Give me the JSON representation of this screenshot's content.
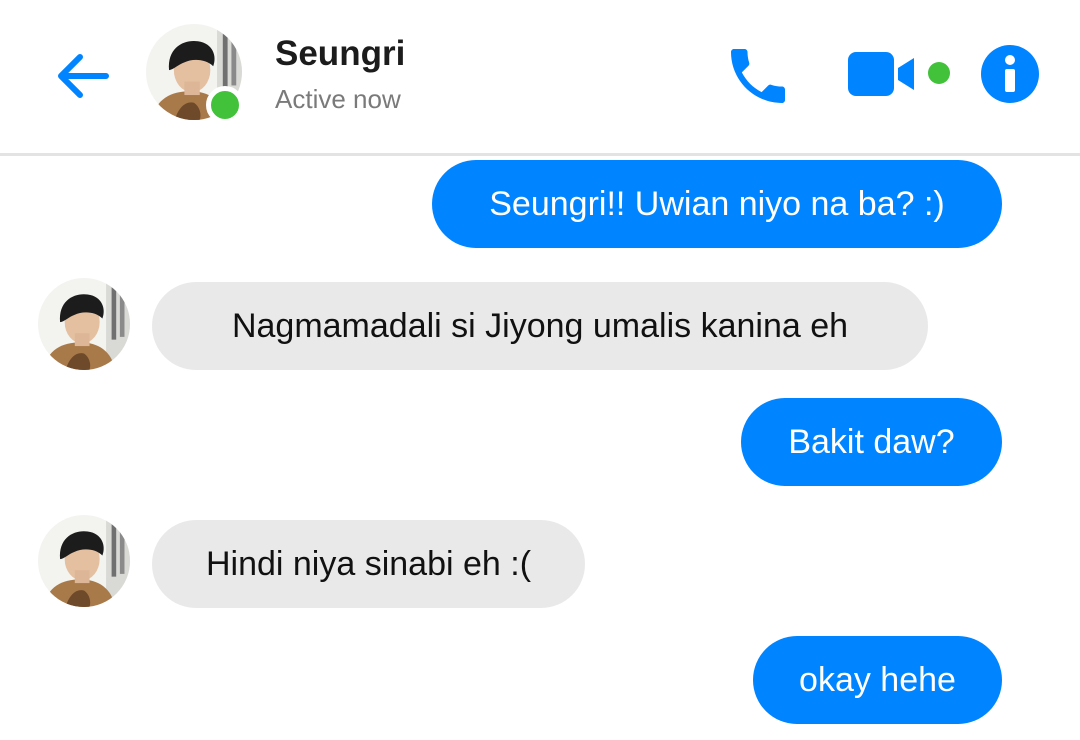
{
  "header": {
    "contact_name": "Seungri",
    "status": "Active now",
    "icons": {
      "back": "back-arrow-icon",
      "call": "phone-icon",
      "video": "video-camera-icon",
      "info": "info-icon"
    }
  },
  "colors": {
    "accent": "#0084ff",
    "online": "#42c23a",
    "incoming_bubble": "#e9e9e9",
    "divider": "#e3e3e3"
  },
  "messages": [
    {
      "direction": "outgoing",
      "text": "Seungri!! Uwian niyo na ba? :)"
    },
    {
      "direction": "incoming",
      "text": "Nagmamadali si Jiyong umalis kanina eh"
    },
    {
      "direction": "outgoing",
      "text": "Bakit daw?"
    },
    {
      "direction": "incoming",
      "text": "Hindi niya sinabi eh :("
    },
    {
      "direction": "outgoing",
      "text": "okay hehe"
    }
  ]
}
